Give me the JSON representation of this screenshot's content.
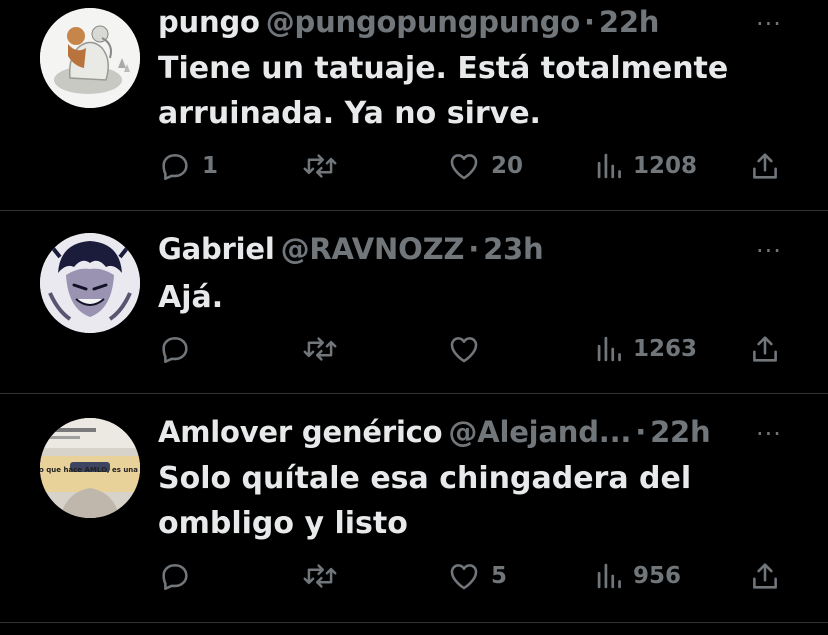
{
  "tweets": [
    {
      "name": "pungo",
      "handle": "@pungopungpungo",
      "separator": "·",
      "time": "22h",
      "text": "Tiene un tatuaje. Está totalmente arruinada. Ya no sirve.",
      "more": "···",
      "replies": "1",
      "retweets": "",
      "likes": "20",
      "views": "1208",
      "avatar": "avatar-artwork-figure"
    },
    {
      "name": "Gabriel",
      "handle": "@RAVNOZZ",
      "separator": "·",
      "time": "23h",
      "text": "Ajá.",
      "more": "···",
      "replies": "",
      "retweets": "",
      "likes": "",
      "views": "1263",
      "avatar": "avatar-anime-character"
    },
    {
      "name": "Amlover genérico",
      "handle": "@Alejand...",
      "separator": "·",
      "time": "22h",
      "text": "Solo quítale esa chingadera del ombligo y listo",
      "more": "···",
      "replies": "",
      "retweets": "",
      "likes": "5",
      "views": "956",
      "avatar": "avatar-meme-photo",
      "avatar_caption": "Cada movimiento que hace AMLO, es una jugada maestra."
    }
  ],
  "colors": {
    "background": "#000000",
    "text": "#e7e9ea",
    "secondary": "#71767b",
    "divider": "#2f3336"
  }
}
